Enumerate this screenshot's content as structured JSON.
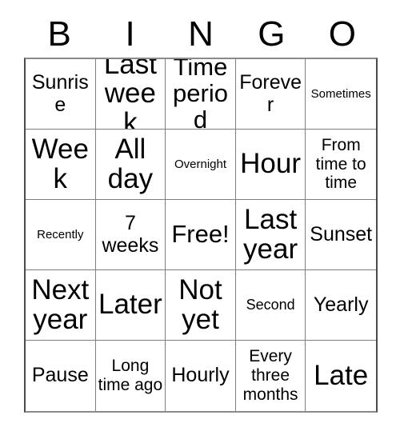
{
  "card": {
    "headers": [
      "B",
      "I",
      "N",
      "G",
      "O"
    ],
    "rows": [
      [
        {
          "text": "Sunrise",
          "size": "sz-l"
        },
        {
          "text": "Last week",
          "size": "sz-xxl"
        },
        {
          "text": "Time period",
          "size": "sz-xl"
        },
        {
          "text": "Forever",
          "size": "sz-l"
        },
        {
          "text": "Sometimes",
          "size": "sz-xs"
        }
      ],
      [
        {
          "text": "Week",
          "size": "sz-xxl"
        },
        {
          "text": "All day",
          "size": "sz-xxl"
        },
        {
          "text": "Overnight",
          "size": "sz-xs"
        },
        {
          "text": "Hour",
          "size": "sz-xxl"
        },
        {
          "text": "From time to time",
          "size": "sz-m"
        }
      ],
      [
        {
          "text": "Recently",
          "size": "sz-xs"
        },
        {
          "text": "7 weeks",
          "size": "sz-l"
        },
        {
          "text": "Free!",
          "size": "sz-xl"
        },
        {
          "text": "Last year",
          "size": "sz-xxl"
        },
        {
          "text": "Sunset",
          "size": "sz-l"
        }
      ],
      [
        {
          "text": "Next year",
          "size": "sz-xxl"
        },
        {
          "text": "Later",
          "size": "sz-xxl"
        },
        {
          "text": "Not yet",
          "size": "sz-xxl"
        },
        {
          "text": "Second",
          "size": "sz-s"
        },
        {
          "text": "Yearly",
          "size": "sz-l"
        }
      ],
      [
        {
          "text": "Pause",
          "size": "sz-l"
        },
        {
          "text": "Long time ago",
          "size": "sz-m"
        },
        {
          "text": "Hourly",
          "size": "sz-l"
        },
        {
          "text": "Every three months",
          "size": "sz-m"
        },
        {
          "text": "Late",
          "size": "sz-xxl"
        }
      ]
    ],
    "colors": {
      "text": "#000000",
      "background": "#ffffff",
      "grid_line": "#808080",
      "outer_border": "#4a4a4a"
    }
  }
}
